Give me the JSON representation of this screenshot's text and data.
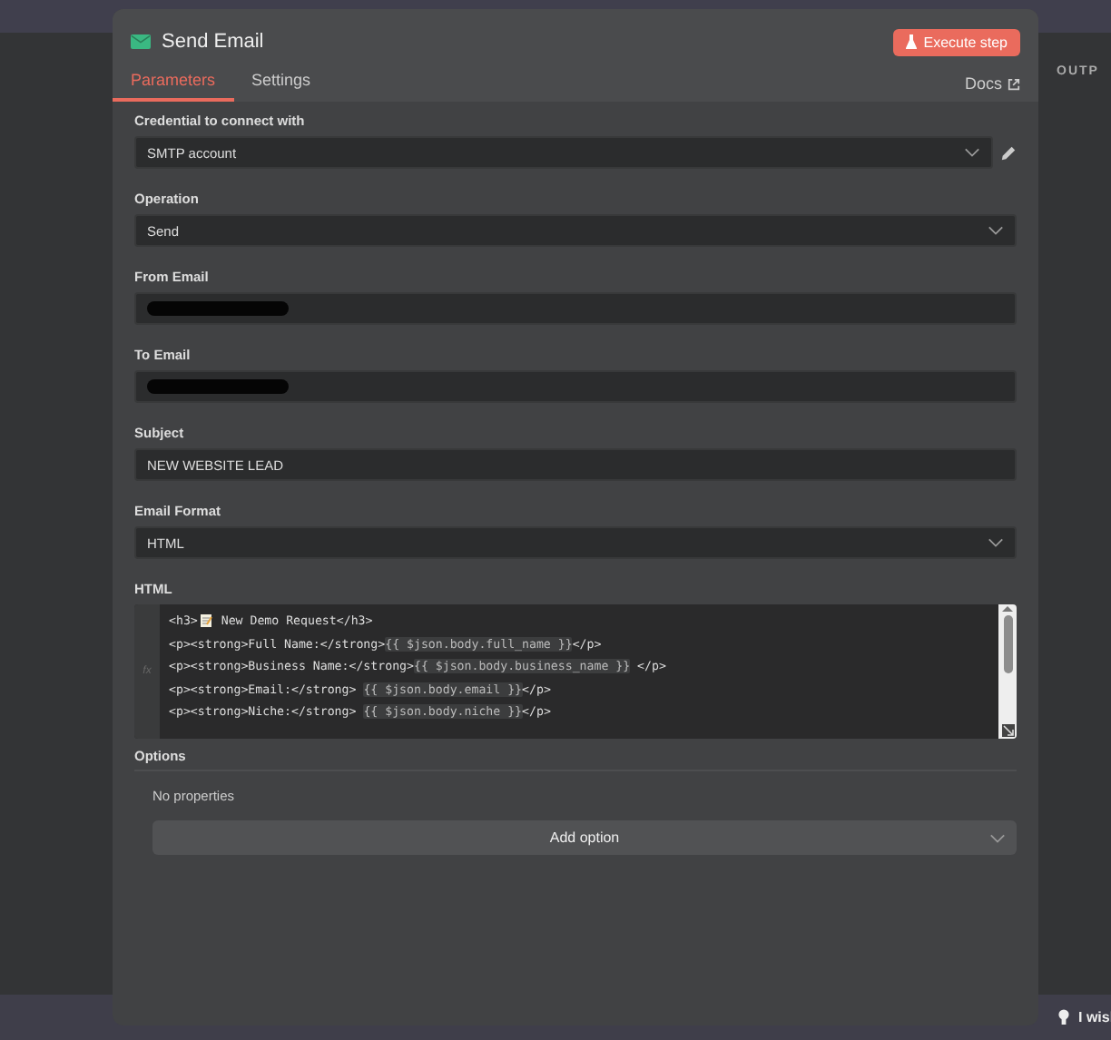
{
  "background": {
    "right_panel_title": "OUTP",
    "hint_text": "I wisl"
  },
  "dialog": {
    "title": "Send Email",
    "execute_button": "Execute step",
    "tabs": [
      {
        "label": "Parameters",
        "selected": true
      },
      {
        "label": "Settings",
        "selected": false
      }
    ],
    "docs_link": "Docs",
    "fields": [
      {
        "label": "Credential to connect with",
        "kind": "select",
        "value": "SMTP account",
        "editable": true
      },
      {
        "label": "Operation",
        "kind": "select",
        "value": "Send"
      },
      {
        "label": "From Email",
        "kind": "text",
        "redacted": true
      },
      {
        "label": "To Email",
        "kind": "text",
        "redacted": true
      },
      {
        "label": "Subject",
        "kind": "text",
        "value": "NEW WEBSITE LEAD"
      },
      {
        "label": "Email Format",
        "kind": "select",
        "value": "HTML"
      }
    ],
    "html_editor": {
      "label": "HTML",
      "gutter": "fx",
      "lines": [
        [
          {
            "kind": "code",
            "text": "<h3>"
          },
          {
            "kind": "memo-icon"
          },
          {
            "kind": "code",
            "text": " New Demo Request</h3>"
          }
        ],
        [
          {
            "kind": "code",
            "text": "<p><strong>Full Name:</strong>"
          },
          {
            "kind": "expr",
            "text": "{{ $json.body.full_name }}"
          },
          {
            "kind": "code",
            "text": "</p>"
          }
        ],
        [
          {
            "kind": "code",
            "text": "<p><strong>Business Name:</strong>"
          },
          {
            "kind": "expr",
            "text": "{{ $json.body.business_name }}"
          },
          {
            "kind": "code",
            "text": " </p>"
          }
        ],
        [
          {
            "kind": "code",
            "text": "<p><strong>Email:</strong> "
          },
          {
            "kind": "expr",
            "text": "{{ $json.body.email }}"
          },
          {
            "kind": "code",
            "text": "</p>"
          }
        ],
        [
          {
            "kind": "code",
            "text": "<p><strong>Niche:</strong> "
          },
          {
            "kind": "expr",
            "text": "{{ $json.body.niche }}"
          },
          {
            "kind": "code",
            "text": "</p>"
          }
        ]
      ]
    },
    "options": {
      "title": "Options",
      "empty_text": "No properties",
      "add_button": "Add option"
    }
  }
}
